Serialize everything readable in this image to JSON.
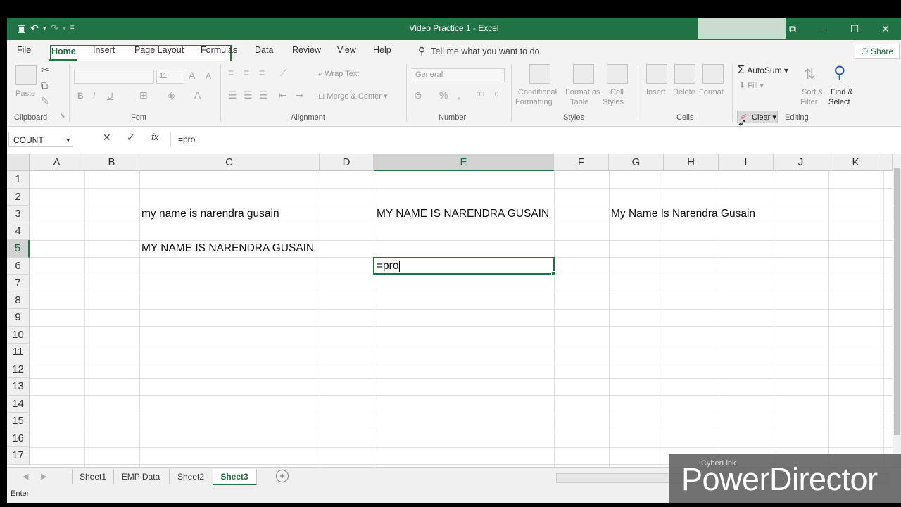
{
  "window": {
    "title": "Video Practice 1  -  Excel"
  },
  "menu": {
    "tabs": [
      "File",
      "Home",
      "Insert",
      "Page Layout",
      "Formulas",
      "Data",
      "Review",
      "View",
      "Help"
    ],
    "active_tab": "Home",
    "tell_me": "Tell me what you want to do",
    "share": "Share"
  },
  "ribbon": {
    "clipboard": {
      "label": "Clipboard",
      "paste": "Paste"
    },
    "font": {
      "label": "Font",
      "size": "11"
    },
    "alignment": {
      "label": "Alignment",
      "wrap_text": "Wrap Text",
      "merge_center": "Merge & Center"
    },
    "number": {
      "label": "Number",
      "format": "General"
    },
    "styles": {
      "label": "Styles",
      "conditional_1": "Conditional",
      "conditional_2": "Formatting",
      "format_as_1": "Format as",
      "format_as_2": "Table",
      "cell_styles_1": "Cell",
      "cell_styles_2": "Styles"
    },
    "cells": {
      "label": "Cells",
      "insert": "Insert",
      "delete": "Delete",
      "format": "Format"
    },
    "editing": {
      "label": "Editing",
      "autosum": "AutoSum",
      "fill": "Fill",
      "clear": "Clear",
      "sort_filter_1": "Sort &",
      "sort_filter_2": "Filter",
      "find_select_1": "Find &",
      "find_select_2": "Select"
    }
  },
  "formula_bar": {
    "name_box": "COUNT",
    "formula": "=pro"
  },
  "grid": {
    "columns": [
      "A",
      "B",
      "C",
      "D",
      "E",
      "F",
      "G",
      "H",
      "I",
      "J",
      "K"
    ],
    "rows": [
      "1",
      "2",
      "3",
      "4",
      "5",
      "6",
      "7",
      "8",
      "9",
      "10",
      "11",
      "12",
      "13",
      "14",
      "15",
      "16",
      "17"
    ],
    "selected_column": "E",
    "selected_row": "5",
    "cells": {
      "C3": "my name is narendra gusain",
      "E3": "MY NAME IS NARENDRA GUSAIN",
      "G3": "My Name Is Narendra Gusain",
      "C5": "MY NAME IS NARENDRA GUSAIN",
      "E5": "=pro"
    }
  },
  "sheets": {
    "tabs": [
      "Sheet1",
      "EMP Data",
      "Sheet2",
      "Sheet3"
    ],
    "active": "Sheet3"
  },
  "status": {
    "mode": "Enter"
  },
  "watermark": {
    "brand_small": "CyberLink",
    "brand_big": "PowerDirector"
  }
}
